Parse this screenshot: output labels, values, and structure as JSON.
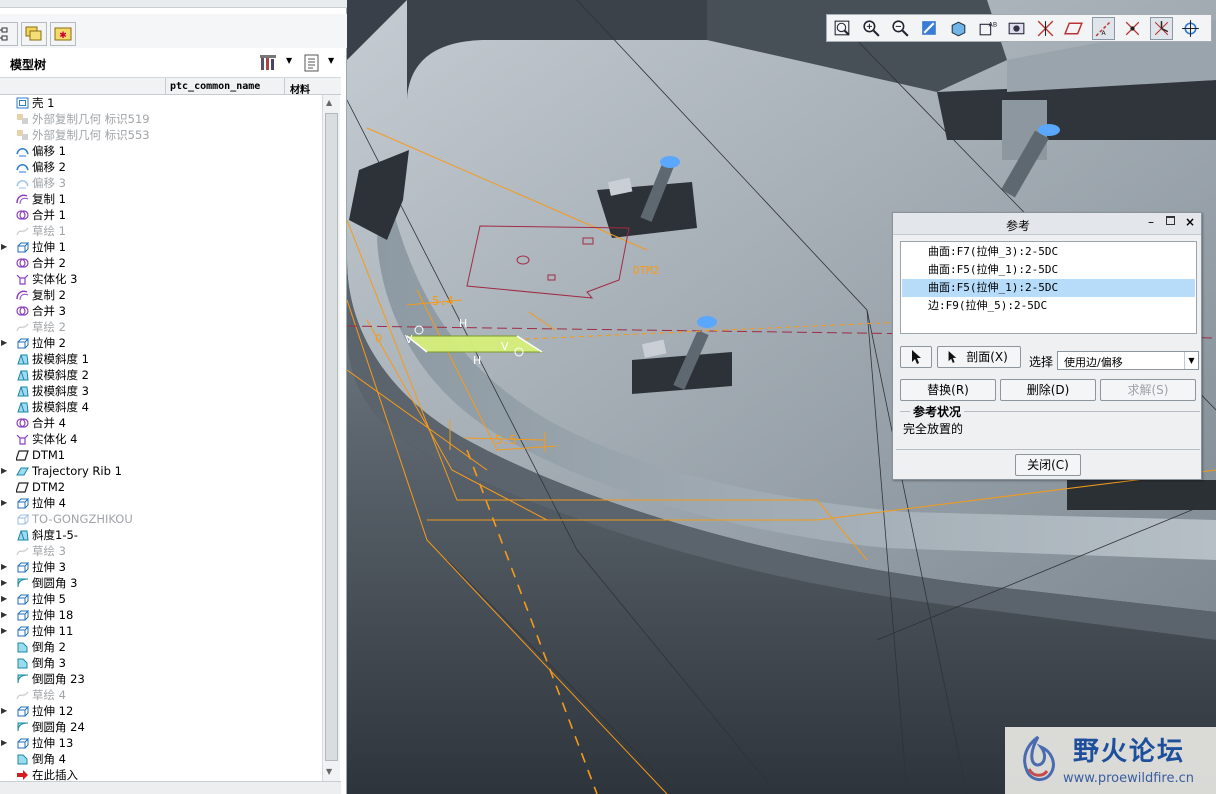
{
  "model_tree": {
    "title": "模型树",
    "columns": [
      "ptc_common_name",
      "材料"
    ],
    "items": [
      {
        "label": "壳 1",
        "icon": "shell-icon",
        "expandable": false,
        "dim": false
      },
      {
        "label": "外部复制几何 标识519",
        "icon": "external-copy-geom-icon",
        "expandable": false,
        "dim": true
      },
      {
        "label": "外部复制几何 标识553",
        "icon": "external-copy-geom-icon",
        "expandable": false,
        "dim": true
      },
      {
        "label": "偏移 1",
        "icon": "offset-icon",
        "expandable": false,
        "dim": false
      },
      {
        "label": "偏移 2",
        "icon": "offset-icon",
        "expandable": false,
        "dim": false
      },
      {
        "label": "偏移 3",
        "icon": "offset-icon",
        "expandable": false,
        "dim": true
      },
      {
        "label": "复制 1",
        "icon": "copy-icon",
        "expandable": false,
        "dim": false
      },
      {
        "label": "合并 1",
        "icon": "merge-icon",
        "expandable": false,
        "dim": false
      },
      {
        "label": "草绘 1",
        "icon": "sketch-icon",
        "expandable": false,
        "dim": true
      },
      {
        "label": "拉伸 1",
        "icon": "extrude-icon",
        "expandable": true,
        "dim": false
      },
      {
        "label": "合并 2",
        "icon": "merge-icon",
        "expandable": false,
        "dim": false
      },
      {
        "label": "实体化 3",
        "icon": "solidify-icon",
        "expandable": false,
        "dim": false
      },
      {
        "label": "复制 2",
        "icon": "copy-icon",
        "expandable": false,
        "dim": false
      },
      {
        "label": "合并 3",
        "icon": "merge-icon",
        "expandable": false,
        "dim": false
      },
      {
        "label": "草绘 2",
        "icon": "sketch-icon",
        "expandable": false,
        "dim": true
      },
      {
        "label": "拉伸 2",
        "icon": "extrude-icon",
        "expandable": true,
        "dim": false
      },
      {
        "label": "拔模斜度 1",
        "icon": "draft-icon",
        "expandable": false,
        "dim": false
      },
      {
        "label": "拔模斜度 2",
        "icon": "draft-icon",
        "expandable": false,
        "dim": false
      },
      {
        "label": "拔模斜度 3",
        "icon": "draft-icon",
        "expandable": false,
        "dim": false
      },
      {
        "label": "拔模斜度 4",
        "icon": "draft-icon",
        "expandable": false,
        "dim": false
      },
      {
        "label": "合并 4",
        "icon": "merge-icon",
        "expandable": false,
        "dim": false
      },
      {
        "label": "实体化 4",
        "icon": "solidify-icon",
        "expandable": false,
        "dim": false
      },
      {
        "label": "DTM1",
        "icon": "datum-plane-icon",
        "expandable": false,
        "dim": false
      },
      {
        "label": "Trajectory Rib 1",
        "icon": "rib-icon",
        "expandable": true,
        "dim": false
      },
      {
        "label": "DTM2",
        "icon": "datum-plane-icon",
        "expandable": false,
        "dim": false
      },
      {
        "label": "拉伸 4",
        "icon": "extrude-icon",
        "expandable": true,
        "dim": false
      },
      {
        "label": "TO-GONGZHIKOU",
        "icon": "extrude-icon",
        "expandable": false,
        "dim": true
      },
      {
        "label": "斜度1-5-",
        "icon": "draft-icon",
        "expandable": false,
        "dim": false
      },
      {
        "label": "草绘 3",
        "icon": "sketch-icon",
        "expandable": false,
        "dim": true
      },
      {
        "label": "拉伸 3",
        "icon": "extrude-icon",
        "expandable": true,
        "dim": false
      },
      {
        "label": "倒圆角 3",
        "icon": "round-icon",
        "expandable": true,
        "dim": false
      },
      {
        "label": "拉伸 5",
        "icon": "extrude-icon",
        "expandable": true,
        "dim": false
      },
      {
        "label": "拉伸 18",
        "icon": "extrude-icon",
        "expandable": true,
        "dim": false
      },
      {
        "label": "拉伸 11",
        "icon": "extrude-icon",
        "expandable": true,
        "dim": false
      },
      {
        "label": "倒角 2",
        "icon": "chamfer-icon",
        "expandable": false,
        "dim": false
      },
      {
        "label": "倒角 3",
        "icon": "chamfer-icon",
        "expandable": false,
        "dim": false
      },
      {
        "label": "倒圆角 23",
        "icon": "round-icon",
        "expandable": false,
        "dim": false
      },
      {
        "label": "草绘 4",
        "icon": "sketch-icon",
        "expandable": false,
        "dim": true
      },
      {
        "label": "拉伸 12",
        "icon": "extrude-icon",
        "expandable": true,
        "dim": false
      },
      {
        "label": "倒圆角 24",
        "icon": "round-icon",
        "expandable": false,
        "dim": false
      },
      {
        "label": "拉伸 13",
        "icon": "extrude-icon",
        "expandable": true,
        "dim": false
      },
      {
        "label": "倒角 4",
        "icon": "chamfer-icon",
        "expandable": false,
        "dim": false
      },
      {
        "label": "在此插入",
        "icon": "insert-here-arrow-icon",
        "expandable": false,
        "dim": false
      }
    ]
  },
  "toolbar": {
    "icons": [
      "refit-icon",
      "zoom-in-icon",
      "zoom-out-icon",
      "repaint-icon",
      "view-orient-icon",
      "saved-views-icon",
      "shading-icon",
      "datum-display-icon",
      "datum-plane-display-icon",
      "datum-axis-display-icon",
      "point-display-icon",
      "csys-display-icon",
      "spin-center-icon"
    ],
    "active": [
      9,
      11
    ]
  },
  "viewport": {
    "annotations": {
      "datum_label": "DTM2",
      "dim_top": "5.4",
      "dim_bottom": "5.5",
      "h1": "H",
      "h2": "H",
      "v1": "V",
      "v2": "V",
      "left_dim": "0"
    }
  },
  "ref_dialog": {
    "title": "参考",
    "references": [
      {
        "label": "曲面:F7(拉伸_3):2-5DC",
        "selected": false
      },
      {
        "label": "曲面:F5(拉伸_1):2-5DC",
        "selected": false
      },
      {
        "label": "曲面:F5(拉伸_1):2-5DC",
        "selected": true
      },
      {
        "label": "边:F9(拉伸_5):2-5DC",
        "selected": false
      }
    ],
    "section_button": "剖面(X)",
    "select_label": "选择",
    "select_value": "使用边/偏移",
    "replace_button": "替换(R)",
    "delete_button": "删除(D)",
    "solve_button": "求解(S)",
    "status_title": "参考状况",
    "status_value": "完全放置的",
    "close_button": "关闭(C)"
  },
  "watermark": {
    "cn": "野火论坛",
    "url": "www.proewildfire.cn"
  },
  "colors": {
    "selection": "#b6dcf9",
    "orange": "#f59a1a",
    "viewport_bg": "#3a4049",
    "part_gray": "#a9b3bb"
  }
}
